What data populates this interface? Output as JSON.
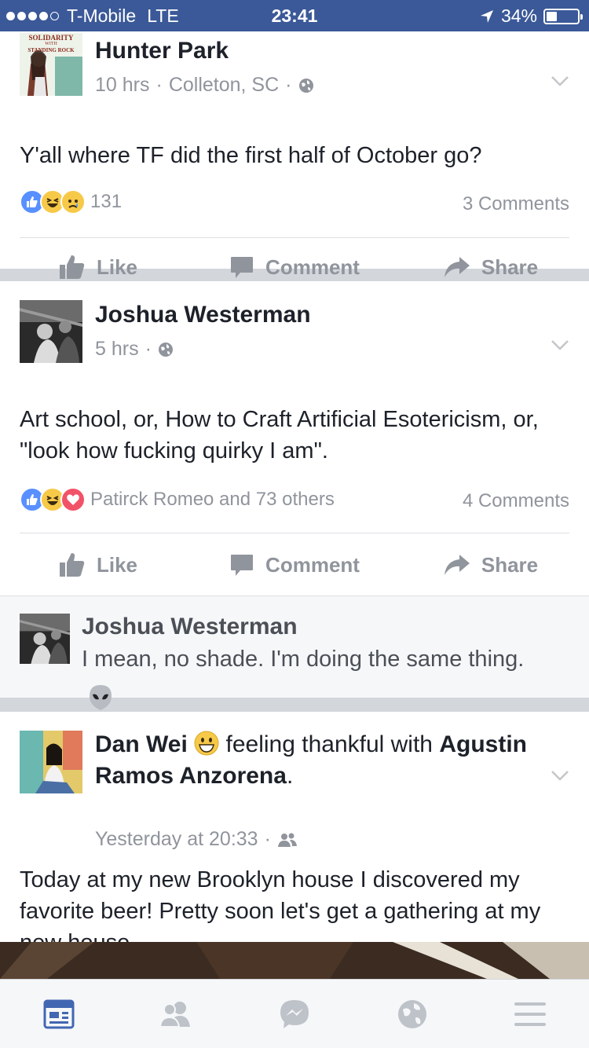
{
  "status_bar": {
    "carrier": "T-Mobile",
    "network": "LTE",
    "time": "23:41",
    "battery": "34%",
    "battery_level": 0.34
  },
  "posts": [
    {
      "author": "Hunter Park",
      "time": "10 hrs",
      "location": "Colleton, SC",
      "privacy_icon": "globe-icon",
      "text": "Y'all where TF did the first half of October go?",
      "reaction_icons": [
        "like",
        "haha",
        "sad"
      ],
      "reaction_summary": "131",
      "comments": "3 Comments",
      "avatar_badge_lines": [
        "SOLIDARITY",
        "WITH",
        "STANDING ROCK"
      ]
    },
    {
      "author": "Joshua Westerman",
      "time": "5 hrs",
      "privacy_icon": "globe-icon",
      "text": "Art school, or, How to Craft Artificial Esotericism, or, \"look how fucking quirky I am\".",
      "reaction_icons": [
        "like",
        "haha",
        "love"
      ],
      "reaction_summary": "Patirck Romeo and 73 others",
      "comments": "4 Comments",
      "top_comment": {
        "author": "Joshua Westerman",
        "text": "I mean, no shade. I'm doing the same thing."
      }
    },
    {
      "author": "Dan Wei",
      "feeling": "feeling thankful with",
      "tagged": "Agustin Ramos Anzorena",
      "time": "Yesterday at 20:33",
      "privacy_icon": "friends-icon",
      "text": "Today at my new Brooklyn house I discovered my favorite beer! Pretty soon let's get a gathering at my new house."
    }
  ],
  "actions": {
    "like": "Like",
    "comment": "Comment",
    "share": "Share"
  },
  "tabs": [
    "news-feed-icon",
    "friend-requests-icon",
    "messenger-icon",
    "notifications-globe-icon",
    "more-menu-icon"
  ],
  "colors": {
    "brand": "#3b5998",
    "active_tab": "#4267b2",
    "inactive": "#90949c",
    "like_blue": "#5890ff",
    "haha_yellow": "#f7c948",
    "love_red": "#f25268"
  }
}
